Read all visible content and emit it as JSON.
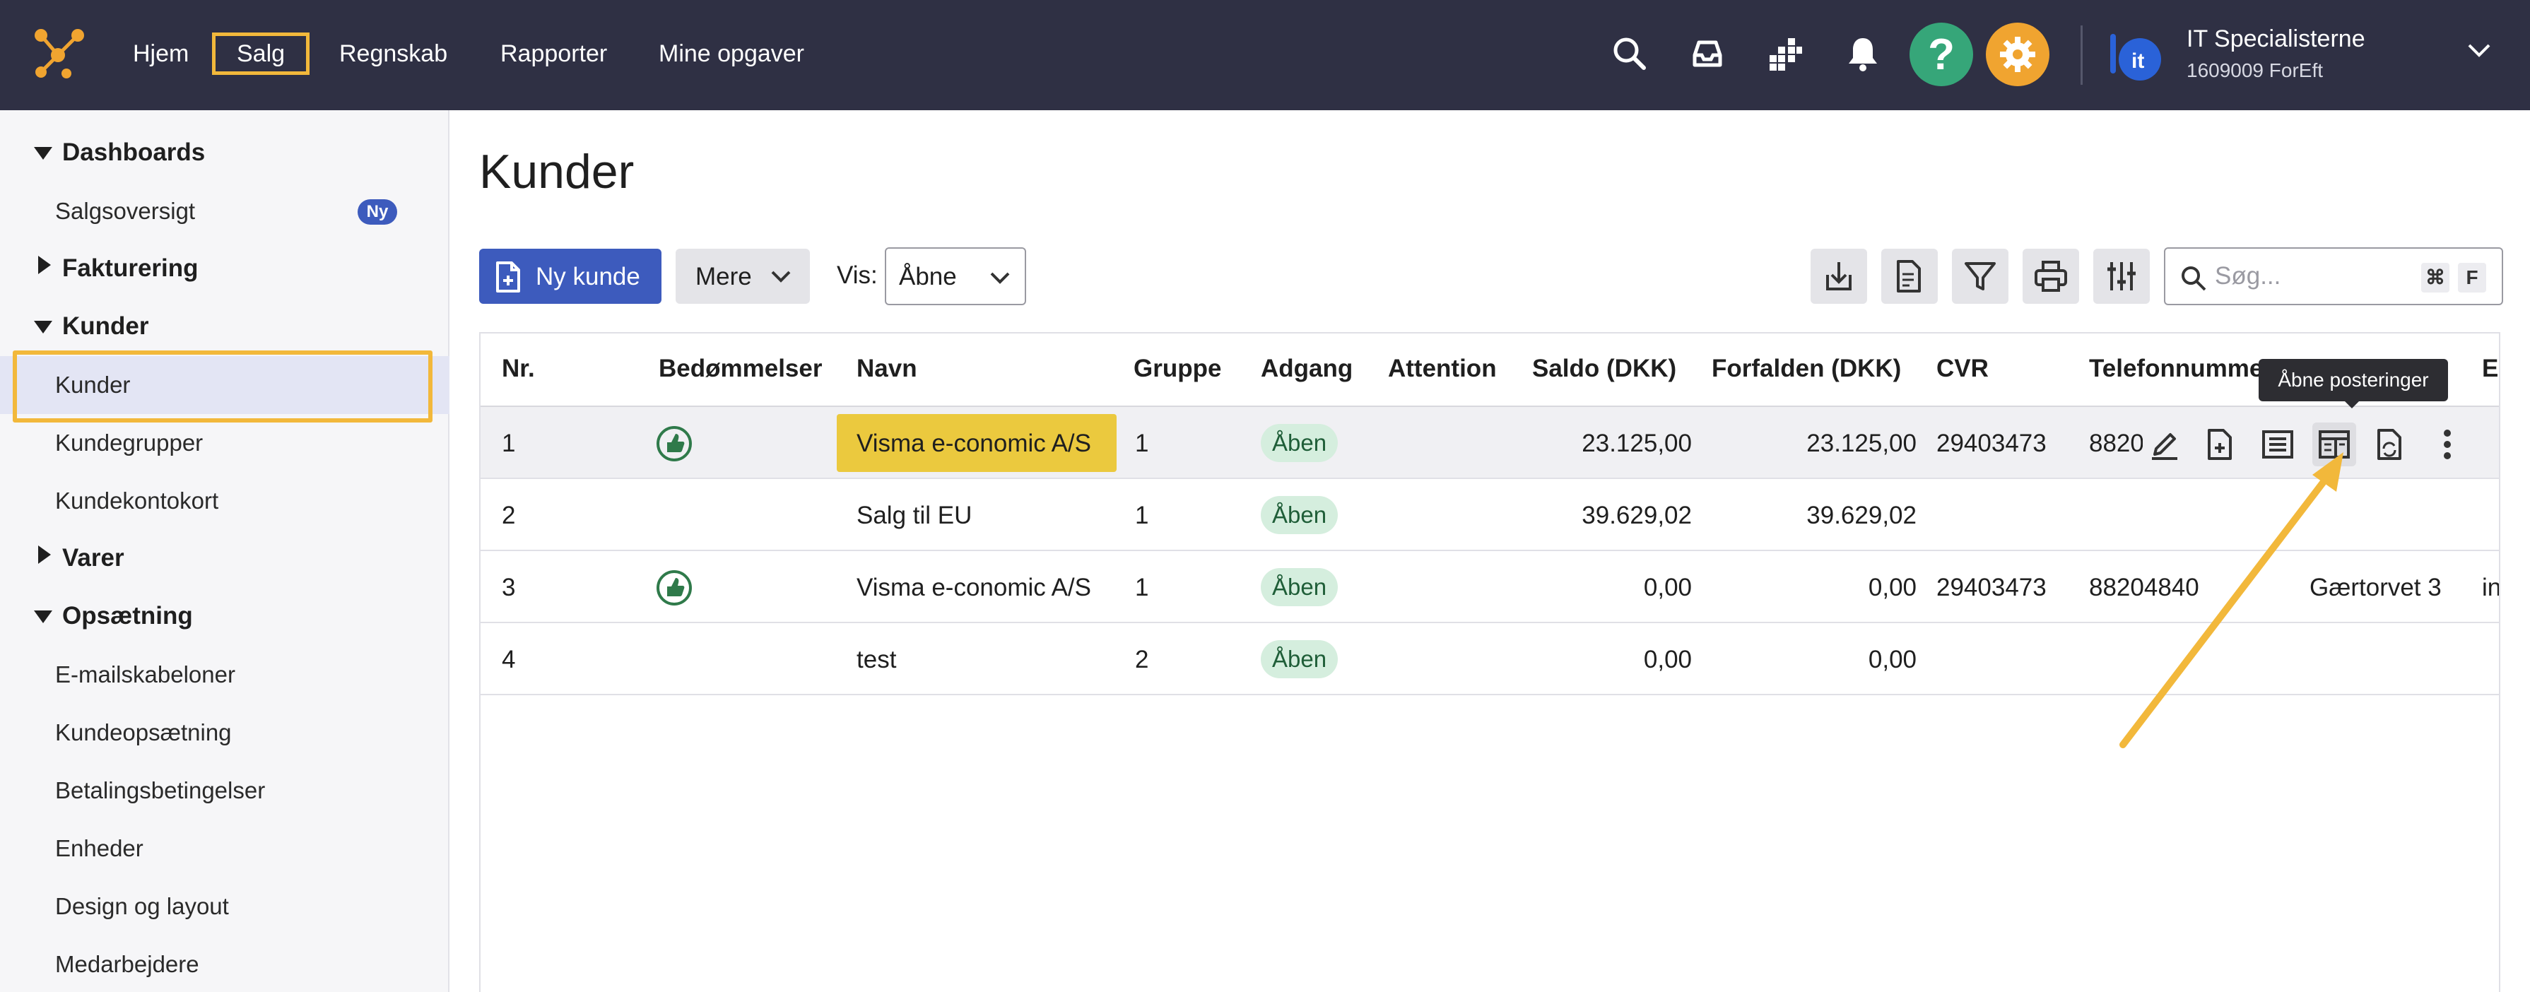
{
  "colors": {
    "topbar": "#2f3044",
    "accent": "#3d5bbd",
    "highlight": "#f2b83b",
    "help": "#36a679",
    "settings": "#f0a430"
  },
  "topbar": {
    "logo": "economic-logo",
    "nav": [
      {
        "label": "Hjem"
      },
      {
        "label": "Salg",
        "active": true
      },
      {
        "label": "Regnskab"
      },
      {
        "label": "Rapporter"
      },
      {
        "label": "Mine opgaver"
      }
    ],
    "icons": [
      "search-icon",
      "inbox-icon",
      "apps-icon",
      "bell-icon",
      "help-icon",
      "settings-icon"
    ],
    "company": {
      "name": "IT Specialisterne",
      "sub": "1609009 ForEft"
    }
  },
  "sidebar": {
    "sections": [
      {
        "label": "Dashboards",
        "expanded": true
      },
      {
        "label": "Salgsoversigt",
        "badge": "Ny"
      },
      {
        "label": "Fakturering",
        "expanded": false
      },
      {
        "label": "Kunder",
        "expanded": true
      },
      {
        "label": "Kunder",
        "selected": true
      },
      {
        "label": "Kundegrupper"
      },
      {
        "label": "Kundekontokort"
      },
      {
        "label": "Varer",
        "expanded": false
      },
      {
        "label": "Opsætning",
        "expanded": true
      },
      {
        "label": "E-mailskabeloner"
      },
      {
        "label": "Kundeopsætning"
      },
      {
        "label": "Betalingsbetingelser"
      },
      {
        "label": "Enheder"
      },
      {
        "label": "Design og layout"
      },
      {
        "label": "Medarbejdere"
      }
    ]
  },
  "main": {
    "title": "Kunder",
    "new_button": "Ny kunde",
    "more_button": "Mere",
    "vis_label": "Vis:",
    "vis_value": "Åbne",
    "tool_icons": [
      "import-icon",
      "export-icon",
      "filter-icon",
      "print-icon",
      "columns-settings-icon"
    ],
    "search": {
      "placeholder": "Søg...",
      "shortcut_cmd": "⌘",
      "shortcut_key": "F"
    }
  },
  "table": {
    "columns": [
      "Nr.",
      "Bedømmelser",
      "Navn",
      "Gruppe",
      "Adgang",
      "Attention",
      "Saldo (DKK)",
      "Forfalden (DKK)",
      "CVR",
      "Telefonnummer",
      "E-"
    ],
    "rows": [
      {
        "nr": "1",
        "rating": true,
        "name": "Visma e-conomic A/S",
        "group": "1",
        "access": "Åben",
        "saldo": "23.125,00",
        "overdue": "23.125,00",
        "cvr": "29403473",
        "phone": "8820",
        "address": "",
        "email": ""
      },
      {
        "nr": "2",
        "rating": false,
        "name": "Salg til EU",
        "group": "1",
        "access": "Åben",
        "saldo": "39.629,02",
        "overdue": "39.629,02",
        "cvr": "",
        "phone": "",
        "address": "",
        "email": ""
      },
      {
        "nr": "3",
        "rating": true,
        "name": "Visma e-conomic A/S",
        "group": "1",
        "access": "Åben",
        "saldo": "0,00",
        "overdue": "0,00",
        "cvr": "29403473",
        "phone": "88204840",
        "address": "Gærtorvet 3",
        "email": "in"
      },
      {
        "nr": "4",
        "rating": false,
        "name": "test",
        "group": "2",
        "access": "Åben",
        "saldo": "0,00",
        "overdue": "0,00",
        "cvr": "",
        "phone": "",
        "address": "",
        "email": ""
      }
    ],
    "row_actions": [
      "edit-icon",
      "new-invoice-icon",
      "list-icon",
      "open-entries-icon",
      "sync-document-icon",
      "more-vertical-icon"
    ],
    "tooltip": "Åbne posteringer"
  }
}
